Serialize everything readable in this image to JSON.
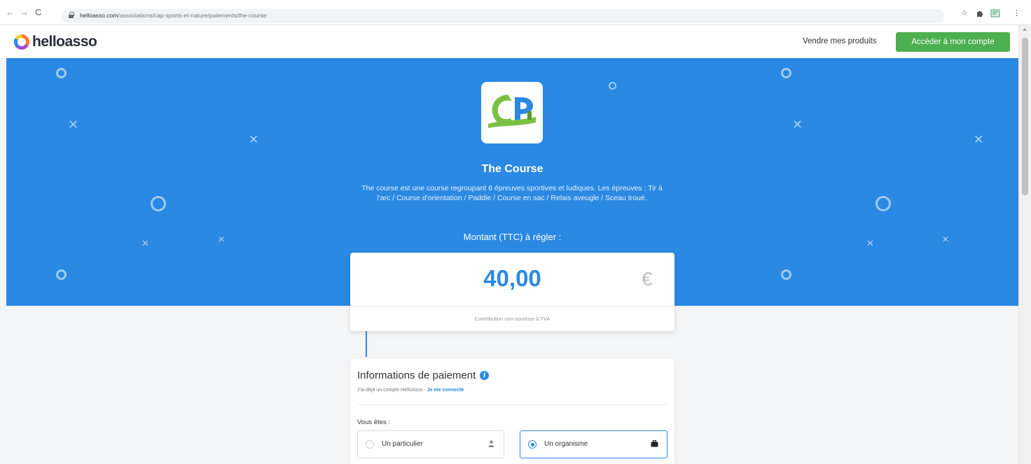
{
  "browser": {
    "back_icon": "←",
    "forward_icon": "→",
    "reload_icon": "C",
    "url_host": "helloasso.com",
    "url_path": "/associations/cap-sports-et-nature/paiements/the-course",
    "star_icon": "☆",
    "extensions_icon": "puzzle",
    "menu_icon": "⋮"
  },
  "header": {
    "logo_text": "helloasso",
    "sell_link": "Vendre mes produits",
    "account_button": "Accéder à mon compte"
  },
  "hero": {
    "title": "The Course",
    "description": "The course est une course regroupant 6 épreuves sportives et ludiques. Les épreuves : Tir à l'arc / Course d'orientation / Paddle / Course en sac / Relais aveugle / Sceau troué.",
    "amount_label": "Montant (TTC) à régler :"
  },
  "amount_card": {
    "value": "40,00",
    "currency": "€",
    "note": "Contribution non-soumise à TVA"
  },
  "payment": {
    "title": "Informations de paiement",
    "info_icon": "i",
    "existing_account_text": "J'ai déjà un compte HelloAsso - ",
    "login_link": "Je me connecte",
    "vous_etes_label": "Vous êtes :",
    "options": [
      {
        "label": "Un particulier",
        "selected": false
      },
      {
        "label": "Un organisme",
        "selected": true
      }
    ]
  },
  "colors": {
    "brand_blue": "#2a89e3",
    "cta_green": "#4caf50"
  }
}
